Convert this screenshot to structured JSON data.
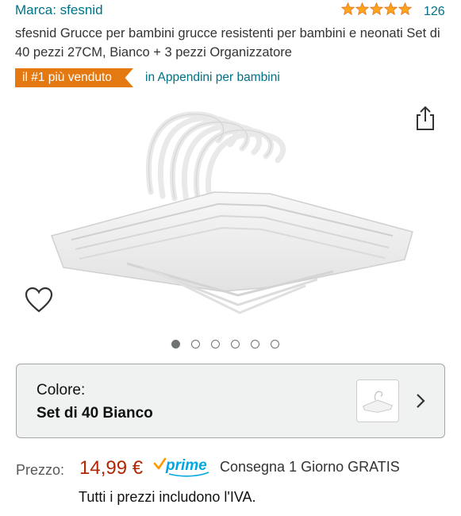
{
  "brand": {
    "label": "Marca: sfesnid"
  },
  "rating": {
    "stars": 5,
    "count": "126"
  },
  "product": {
    "title": "sfesnid Grucce per bambini grucce resistenti per bambini e neonati Set di 40 pezzi 27CM, Bianco + 3 pezzi Organizzatore"
  },
  "badge": {
    "label": "il #1 più venduto",
    "category": "in Appendini per bambini"
  },
  "gallery": {
    "image_count": 6,
    "active_index": 0,
    "icons": [
      "share-icon",
      "heart-icon"
    ]
  },
  "variant": {
    "label": "Colore:",
    "value": "Set di 40 Bianco"
  },
  "price": {
    "label": "Prezzo:",
    "value": "14,99 €",
    "prime_label": "prime",
    "delivery": "Consegna 1 Giorno GRATIS",
    "vat_note": "Tutti i prezzi includono l'IVA."
  },
  "colors": {
    "link": "#007185",
    "badge": "#e47911",
    "price": "#b12704",
    "star": "#ffa41c",
    "prime": "#00a8e1"
  }
}
